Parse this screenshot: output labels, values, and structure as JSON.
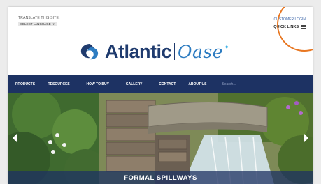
{
  "header": {
    "translate_label": "TRANSLATE THIS SITE:",
    "language_select": "SELECT LANGUAGE",
    "customer_login": "CUSTOMER LOGIN",
    "quick_links": "QUICK LINKS"
  },
  "logo": {
    "brand_primary": "Atlantic",
    "brand_secondary": "Oase"
  },
  "nav": {
    "items": [
      {
        "label": "PRODUCTS",
        "dropdown": false
      },
      {
        "label": "RESOURCES",
        "dropdown": true
      },
      {
        "label": "HOW TO BUY",
        "dropdown": true
      },
      {
        "label": "GALLERY",
        "dropdown": true
      },
      {
        "label": "CONTACT",
        "dropdown": false
      },
      {
        "label": "ABOUT US",
        "dropdown": false
      }
    ],
    "search_placeholder": "Search..."
  },
  "hero": {
    "caption": "FORMAL SPILLWAYS"
  },
  "colors": {
    "nav_bg": "#1d3263",
    "logo_dark": "#1f3b6e",
    "logo_light": "#2d7cc1",
    "login_link": "#3a64a8",
    "highlight_ring": "#e87722"
  }
}
